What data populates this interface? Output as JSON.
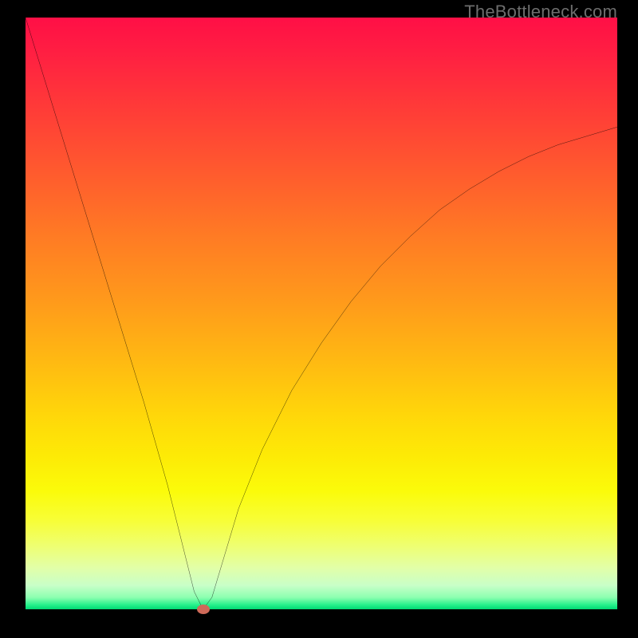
{
  "attribution": "TheBottleneck.com",
  "colors": {
    "frame": "#000000",
    "curve": "#000000",
    "dot": "#cf6a59",
    "gradient_stops": [
      "#ff0f46",
      "#ff1f42",
      "#ff3a38",
      "#ff5a2e",
      "#ff7b24",
      "#ff9a1b",
      "#ffb912",
      "#ffd60a",
      "#fdea06",
      "#fbfb0a",
      "#f7fe37",
      "#eeff74",
      "#e2ffa8",
      "#c8ffc8",
      "#8cffb0",
      "#23f08a",
      "#00d873"
    ]
  },
  "chart_data": {
    "type": "line",
    "title": "",
    "xlabel": "",
    "ylabel": "",
    "xlim": [
      0,
      100
    ],
    "ylim": [
      0,
      100
    ],
    "series": [
      {
        "name": "bottleneck-curve",
        "x": [
          0,
          4,
          8,
          12,
          16,
          20,
          24,
          27,
          28.5,
          30,
          31.5,
          33,
          36,
          40,
          45,
          50,
          55,
          60,
          65,
          70,
          75,
          80,
          85,
          90,
          95,
          100
        ],
        "y": [
          100,
          87,
          74,
          61,
          48,
          35,
          21,
          9,
          3,
          0,
          2,
          7,
          17,
          27,
          37,
          45,
          52,
          58,
          63,
          67.5,
          71,
          74,
          76.5,
          78.5,
          80,
          81.5
        ]
      }
    ],
    "marker": {
      "x": 30,
      "y": 0,
      "name": "optimal-point"
    },
    "grid": false,
    "legend": false
  }
}
